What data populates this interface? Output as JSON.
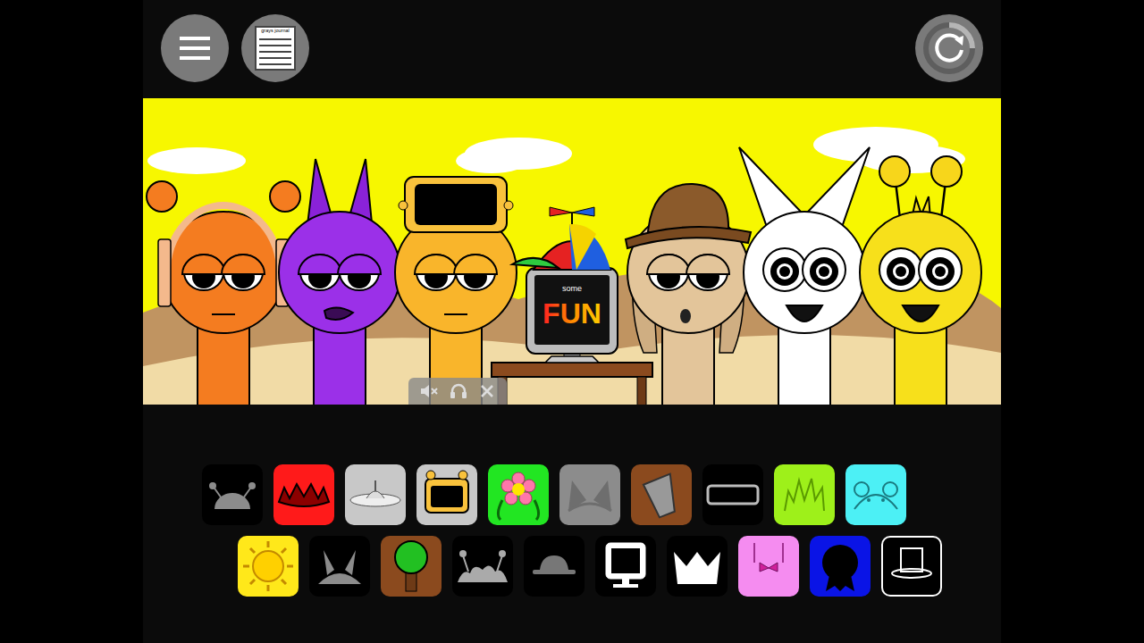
{
  "top_bar": {
    "journal_button": {
      "label": "grays journal"
    }
  },
  "stage": {
    "lineup": [
      {
        "kind": "singer",
        "accessory": "headphones",
        "color": "#f47c20",
        "eyes": "sleepy",
        "mouth": "line"
      },
      {
        "kind": "singer",
        "accessory": "horns",
        "color": "#9b30e8",
        "eyes": "sleepy",
        "mouth": "smirk"
      },
      {
        "kind": "singer",
        "accessory": "visor",
        "color": "#f9b52b",
        "eyes": "sleepy",
        "mouth": "line"
      },
      {
        "kind": "computer",
        "screen_lines": [
          "some",
          "FUN"
        ]
      },
      {
        "kind": "singer",
        "accessory": "hat",
        "color": "#e3c59a",
        "eyes": "sleepy",
        "mouth": "o"
      },
      {
        "kind": "singer",
        "accessory": "cat-ears",
        "color": "#ffffff",
        "eyes": "open",
        "mouth": "smile"
      },
      {
        "kind": "singer",
        "accessory": "antennae",
        "color": "#f7e01b",
        "eyes": "open",
        "mouth": "smile"
      }
    ]
  },
  "palette": {
    "rows": [
      [
        {
          "kind": "antennae-dome",
          "color": "#000000",
          "selected": false
        },
        {
          "kind": "spikes",
          "color": "#ff1a1a",
          "selected": false
        },
        {
          "kind": "ufo",
          "color": "#c8c8c8",
          "selected": false
        },
        {
          "kind": "visor-device",
          "color": "#c8c8c8",
          "selected": false
        },
        {
          "kind": "flower",
          "color": "#22e622",
          "selected": false
        },
        {
          "kind": "cat-ears",
          "color": "#8c8c8c",
          "selected": false
        },
        {
          "kind": "bucket",
          "color": "#8b4a1e",
          "selected": false
        },
        {
          "kind": "visor",
          "color": "#000000",
          "selected": false
        },
        {
          "kind": "spiky-hair",
          "color": "#9ef01a",
          "selected": false
        },
        {
          "kind": "bear-ears",
          "color": "#4cf0f5",
          "selected": false
        }
      ],
      [
        {
          "kind": "sun",
          "color": "#ffe81a",
          "selected": false
        },
        {
          "kind": "horns",
          "color": "#000000",
          "selected": false
        },
        {
          "kind": "tree",
          "color": "#8b4a1e",
          "selected": false
        },
        {
          "kind": "antennae-hair",
          "color": "#000000",
          "selected": false
        },
        {
          "kind": "cap",
          "color": "#000000",
          "selected": false
        },
        {
          "kind": "monitor",
          "color": "#000000",
          "selected": false
        },
        {
          "kind": "crown",
          "color": "#000000",
          "selected": false
        },
        {
          "kind": "bow",
          "color": "#f58cf0",
          "selected": false
        },
        {
          "kind": "ribbon",
          "color": "#0a14e6",
          "selected": false
        },
        {
          "kind": "top-hat",
          "color": "#000000",
          "selected": true
        }
      ]
    ]
  }
}
